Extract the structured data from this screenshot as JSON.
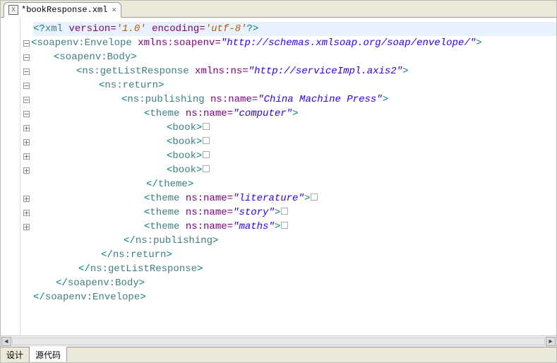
{
  "tab": {
    "icon_letter": "X",
    "title": "*bookResponse.xml",
    "close_glyph": "✕"
  },
  "bottom_tabs": {
    "design": "设计",
    "source": "源代码"
  },
  "code": {
    "lines": [
      {
        "fold": "",
        "indent": 0,
        "kind": "pi",
        "parts": {
          "open": "<?",
          "name": "xml",
          "sp1": " ",
          "a1": "version=",
          "v1": "'1.0'",
          "sp2": " ",
          "a2": "encoding=",
          "v2": "'utf-8'",
          "close": "?>"
        }
      },
      {
        "fold": "minus",
        "indent": 0,
        "kind": "open",
        "tag": "soapenv:Envelope",
        "attrs": [
          {
            "name": "xmlns:soapenv=",
            "value": "\"http://schemas.xmlsoap.org/soap/envelope/\""
          }
        ]
      },
      {
        "fold": "minus",
        "indent": 1,
        "kind": "open",
        "tag": "soapenv:Body"
      },
      {
        "fold": "minus",
        "indent": 2,
        "kind": "open",
        "tag": "ns:getListResponse",
        "attrs": [
          {
            "name": "xmlns:ns=",
            "value": "\"http://serviceImpl.axis2\""
          }
        ]
      },
      {
        "fold": "minus",
        "indent": 3,
        "kind": "open",
        "tag": "ns:return"
      },
      {
        "fold": "minus",
        "indent": 4,
        "kind": "open",
        "tag": "ns:publishing",
        "attrs": [
          {
            "name": "ns:name=",
            "value": "\"China Machine Press\""
          }
        ]
      },
      {
        "fold": "minus",
        "indent": 5,
        "kind": "open",
        "tag": "theme",
        "attrs": [
          {
            "name": "ns:name=",
            "value": "\"computer\""
          }
        ]
      },
      {
        "fold": "plus",
        "indent": 6,
        "kind": "coll",
        "tag": "book"
      },
      {
        "fold": "plus",
        "indent": 6,
        "kind": "coll",
        "tag": "book"
      },
      {
        "fold": "plus",
        "indent": 6,
        "kind": "coll",
        "tag": "book"
      },
      {
        "fold": "plus",
        "indent": 6,
        "kind": "coll",
        "tag": "book"
      },
      {
        "fold": "",
        "indent": 5,
        "kind": "close",
        "tag": "theme"
      },
      {
        "fold": "plus",
        "indent": 5,
        "kind": "collA",
        "tag": "theme",
        "attrs": [
          {
            "name": "ns:name=",
            "value": "\"literature\""
          }
        ]
      },
      {
        "fold": "plus",
        "indent": 5,
        "kind": "collA",
        "tag": "theme",
        "attrs": [
          {
            "name": "ns:name=",
            "value": "\"story\""
          }
        ]
      },
      {
        "fold": "plus",
        "indent": 5,
        "kind": "collA",
        "tag": "theme",
        "attrs": [
          {
            "name": "ns:name=",
            "value": "\"maths\""
          }
        ]
      },
      {
        "fold": "",
        "indent": 4,
        "kind": "close",
        "tag": "ns:publishing"
      },
      {
        "fold": "",
        "indent": 3,
        "kind": "close",
        "tag": "ns:return"
      },
      {
        "fold": "",
        "indent": 2,
        "kind": "close",
        "tag": "ns:getListResponse"
      },
      {
        "fold": "",
        "indent": 1,
        "kind": "close",
        "tag": "soapenv:Body"
      },
      {
        "fold": "",
        "indent": 0,
        "kind": "close",
        "tag": "soapenv:Envelope"
      }
    ]
  }
}
